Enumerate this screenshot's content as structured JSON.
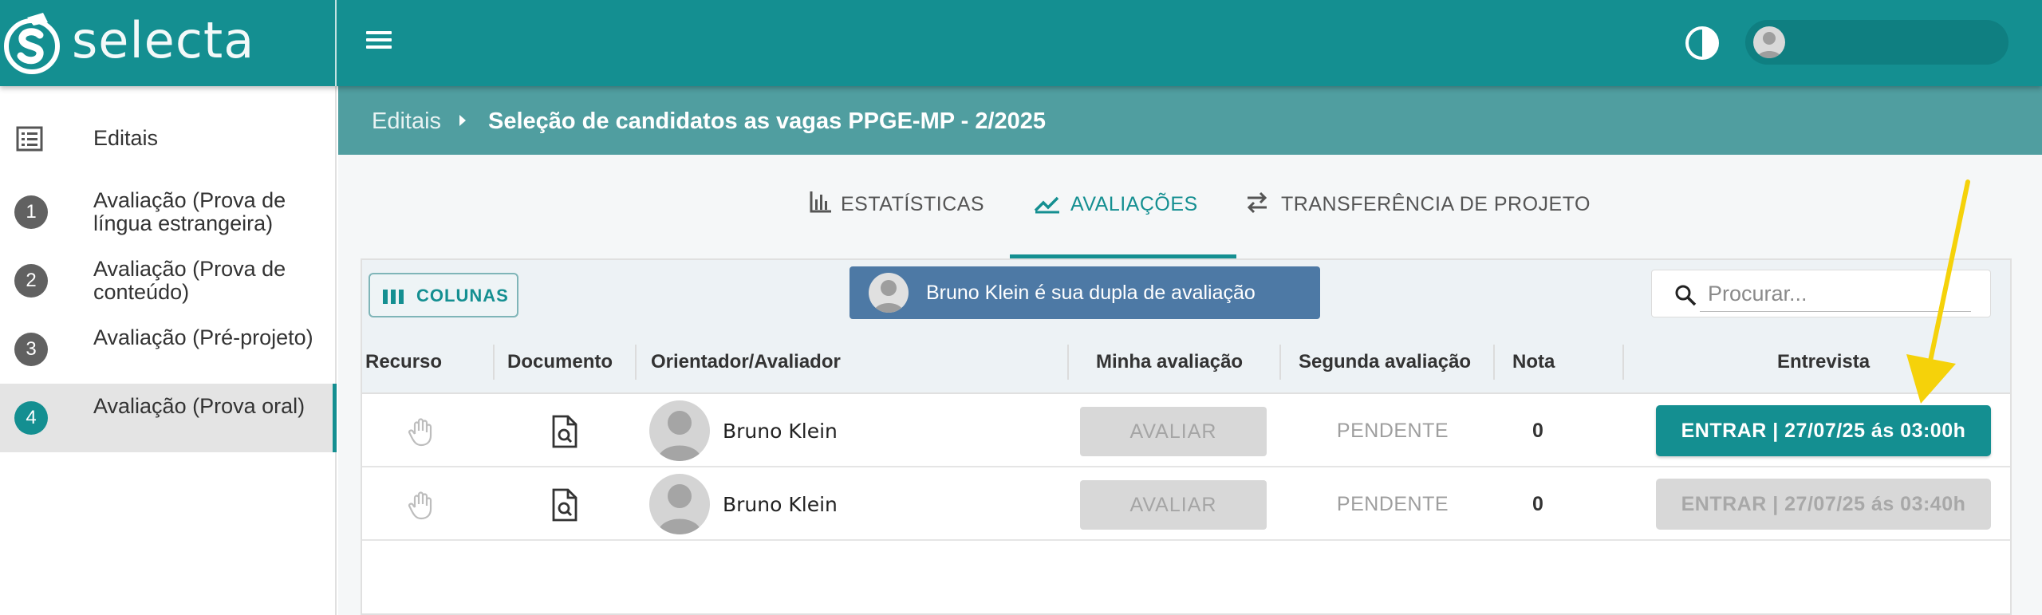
{
  "app": {
    "logo_text": "selecta"
  },
  "sidebar": {
    "editais_label": "Editais",
    "steps": [
      {
        "num": "1",
        "label": "Avaliação (Prova de língua estrangeira)"
      },
      {
        "num": "2",
        "label": "Avaliação (Prova de conteúdo)"
      },
      {
        "num": "3",
        "label": "Avaliação (Pré-projeto)"
      },
      {
        "num": "4",
        "label": "Avaliação (Prova oral)"
      }
    ]
  },
  "breadcrumb": {
    "root": "Editais",
    "current": "Seleção de candidatos as vagas PPGE-MP - 2/2025"
  },
  "tabs": [
    {
      "label": "ESTATÍSTICAS"
    },
    {
      "label": "AVALIAÇÕES"
    },
    {
      "label": "TRANSFERÊNCIA DE PROJETO"
    }
  ],
  "toolbar": {
    "columns_label": "COLUNAS",
    "pair_banner": "Bruno Klein é sua dupla de avaliação",
    "search_placeholder": "Procurar..."
  },
  "table": {
    "headers": [
      "Recurso",
      "Documento",
      "Orientador/Avaliador",
      "Minha avaliação",
      "Segunda avaliação",
      "Nota",
      "Entrevista"
    ],
    "rows": [
      {
        "evaluator": "Bruno Klein",
        "action": "AVALIAR",
        "second": "PENDENTE",
        "nota": "0",
        "entrevista": "ENTRAR | 27/07/25 ás 03:00h"
      },
      {
        "evaluator": "Bruno Klein",
        "action": "AVALIAR",
        "second": "PENDENTE",
        "nota": "0",
        "entrevista": "ENTRAR | 27/07/25 ás 03:40h"
      }
    ]
  },
  "colors": {
    "primary": "#148f91",
    "breadcrumb": "#509ea0",
    "banner": "#4d79a5",
    "annotation_arrow": "#f5d20a"
  }
}
